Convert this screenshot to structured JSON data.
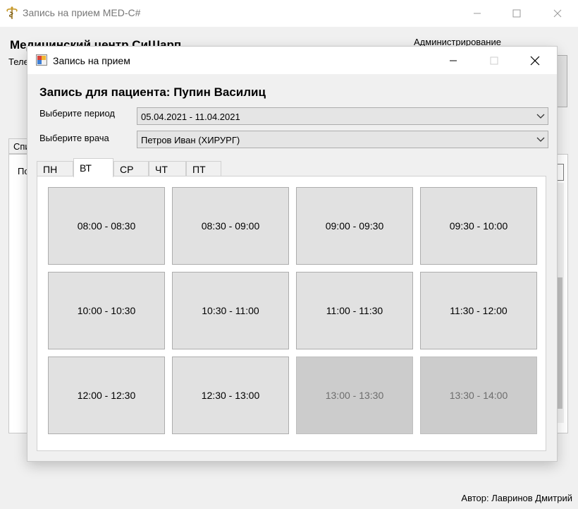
{
  "window": {
    "title": "Запись на прием MED-C#",
    "icon": "caduceus-icon"
  },
  "background": {
    "heading": "Медицинский центр СиШарп",
    "phone_label": "Теле",
    "admin_label": "Администрирование",
    "tab_label": "Спи",
    "panel_label": "По"
  },
  "footer": {
    "author": "Автор: Лавринов Дмитрий"
  },
  "dialog": {
    "title": "Запись на прием",
    "heading": "Запись для пациента: Пупин Василиц",
    "period_label": "Выберите период",
    "period_value": "05.04.2021 - 11.04.2021",
    "doctor_label": "Выберите врача",
    "doctor_value": "Петров Иван (ХИРУРГ)",
    "tabs": [
      {
        "label": "ПН",
        "active": false
      },
      {
        "label": "ВТ",
        "active": true
      },
      {
        "label": "СР",
        "active": false
      },
      {
        "label": "ЧТ",
        "active": false
      },
      {
        "label": "ПТ",
        "active": false
      }
    ],
    "slots": [
      {
        "label": "08:00 - 08:30",
        "enabled": true
      },
      {
        "label": "08:30 - 09:00",
        "enabled": true
      },
      {
        "label": "09:00 - 09:30",
        "enabled": true
      },
      {
        "label": "09:30 - 10:00",
        "enabled": true
      },
      {
        "label": "10:00 - 10:30",
        "enabled": true
      },
      {
        "label": "10:30 - 11:00",
        "enabled": true
      },
      {
        "label": "11:00 - 11:30",
        "enabled": true
      },
      {
        "label": "11:30 - 12:00",
        "enabled": true
      },
      {
        "label": "12:00 - 12:30",
        "enabled": true
      },
      {
        "label": "12:30 - 13:00",
        "enabled": true
      },
      {
        "label": "13:00 - 13:30",
        "enabled": false
      },
      {
        "label": "13:30 - 14:00",
        "enabled": false
      }
    ]
  },
  "colors": {
    "window_bg": "#f0f0f0",
    "slot_enabled": "#e1e1e1",
    "slot_disabled": "#cccccc",
    "slot_disabled_text": "#6d6d6d"
  }
}
